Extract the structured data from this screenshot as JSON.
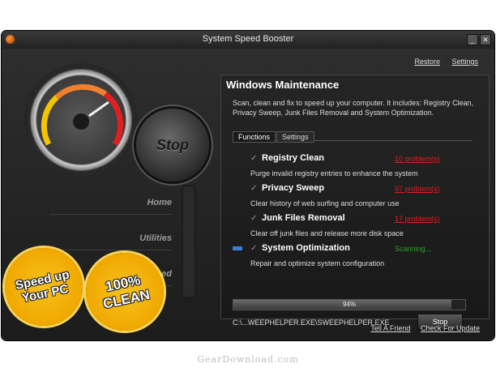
{
  "window": {
    "title": "System Speed Booster"
  },
  "top_links": {
    "restore": "Restore",
    "settings": "Settings"
  },
  "big_stop": "Stop",
  "nav": {
    "home": "Home",
    "utilities": "Utilities",
    "advanced": "ced"
  },
  "badges": {
    "speed": "Speed up\nYour PC",
    "clean": "100%\nCLEAN"
  },
  "panel": {
    "title": "Windows Maintenance",
    "description": "Scan, clean and fix to speed up your computer. It includes: Registry Clean, Privacy Sweep, Junk Files Removal and System Optimization.",
    "tabs": [
      "Functions",
      "Settings"
    ],
    "items": [
      {
        "name": "Registry Clean",
        "status": "10 problem(s)",
        "desc": "Purge invalid registry entries to enhance the system"
      },
      {
        "name": "Privacy Sweep",
        "status": "97 problem(s)",
        "desc": "Clear history of web surfing and computer use"
      },
      {
        "name": "Junk Files Removal",
        "status": "17 problem(s)",
        "desc": "Clear off junk files and release more disk space"
      },
      {
        "name": "System Optimization",
        "status": "Scanning...",
        "desc": "Repair and optimize system configuration"
      }
    ],
    "progress_value": 0.94,
    "progress_label": "94%",
    "current_file": "C:\\...WEEPHELPER.EXE\\SWEEPHELPER.EXE",
    "stop_button": "Stop"
  },
  "bottom_links": {
    "tell": "Tell A Friend",
    "update": "Check For Update"
  },
  "watermark": "GearDownload.com",
  "colors": {
    "problem": "#e02020",
    "scanning": "#2ea02e",
    "accent": "#3b7dd8"
  }
}
